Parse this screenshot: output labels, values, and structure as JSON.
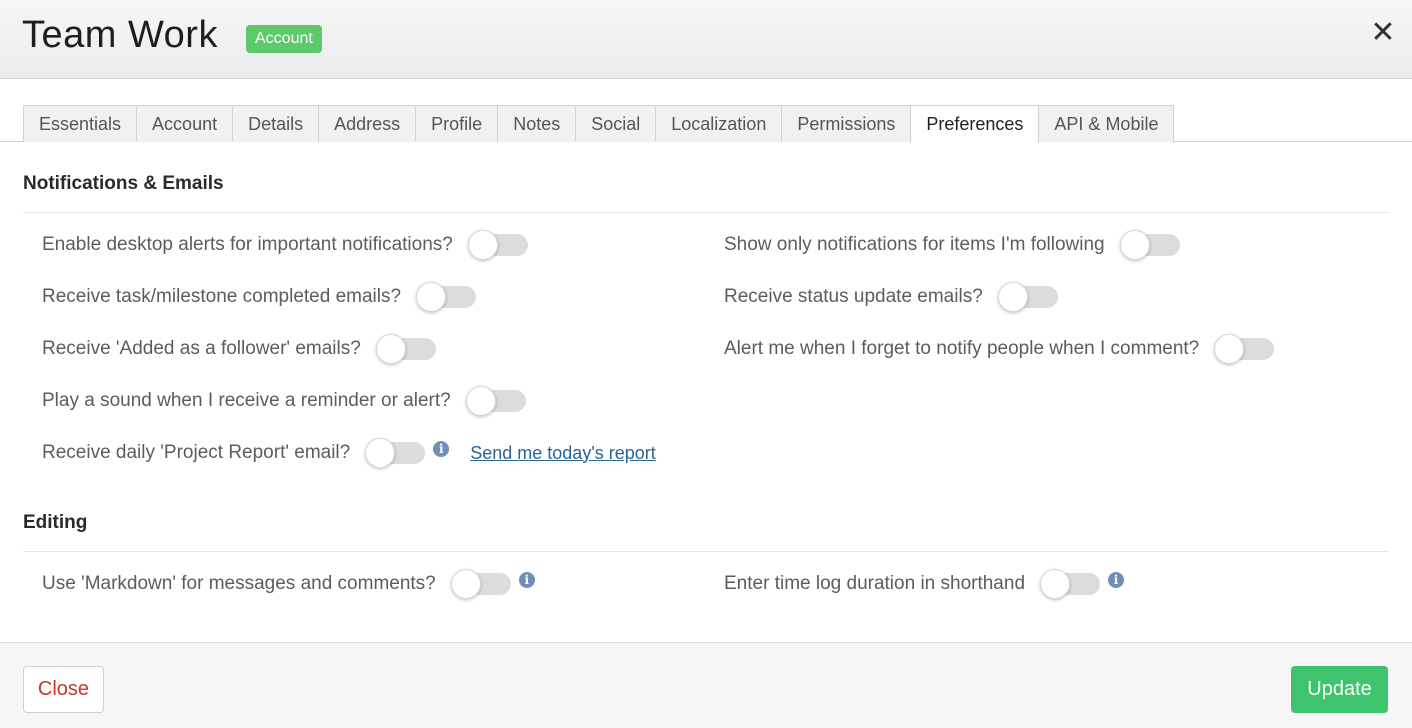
{
  "header": {
    "title": "Team Work",
    "badge": "Account",
    "close_icon": "close-icon"
  },
  "tabs": [
    {
      "label": "Essentials",
      "active": false
    },
    {
      "label": "Account",
      "active": false
    },
    {
      "label": "Details",
      "active": false
    },
    {
      "label": "Address",
      "active": false
    },
    {
      "label": "Profile",
      "active": false
    },
    {
      "label": "Notes",
      "active": false
    },
    {
      "label": "Social",
      "active": false
    },
    {
      "label": "Localization",
      "active": false
    },
    {
      "label": "Permissions",
      "active": false
    },
    {
      "label": "Preferences",
      "active": true
    },
    {
      "label": "API & Mobile",
      "active": false
    }
  ],
  "notifications": {
    "title": "Notifications & Emails",
    "left": [
      {
        "label": "Enable desktop alerts for important notifications?",
        "enabled": false
      },
      {
        "label": "Receive task/milestone completed emails?",
        "enabled": false
      },
      {
        "label": "Receive 'Added as a follower' emails?",
        "enabled": false
      },
      {
        "label": "Play a sound when I receive a reminder or alert?",
        "enabled": false
      },
      {
        "label": "Receive daily 'Project Report' email?",
        "enabled": false,
        "info": true,
        "link": "Send me today's report"
      }
    ],
    "right": [
      {
        "label": "Show only notifications for items I'm following",
        "enabled": false
      },
      {
        "label": "Receive status update emails?",
        "enabled": false
      },
      {
        "label": "Alert me when I forget to notify people when I comment?",
        "enabled": false
      }
    ]
  },
  "editing": {
    "title": "Editing",
    "left": [
      {
        "label": "Use 'Markdown' for messages and comments?",
        "enabled": false,
        "info": true
      }
    ],
    "right": [
      {
        "label": "Enter time log duration in shorthand",
        "enabled": false,
        "info": true
      }
    ]
  },
  "footer": {
    "close_label": "Close",
    "update_label": "Update"
  },
  "colors": {
    "badge": "#5cc96b",
    "update_button": "#3ec46d",
    "close_text": "#c0392b",
    "link": "#2a6496",
    "toggle_off": "#dcdcdc",
    "info_icon": "#6f8fb3"
  }
}
